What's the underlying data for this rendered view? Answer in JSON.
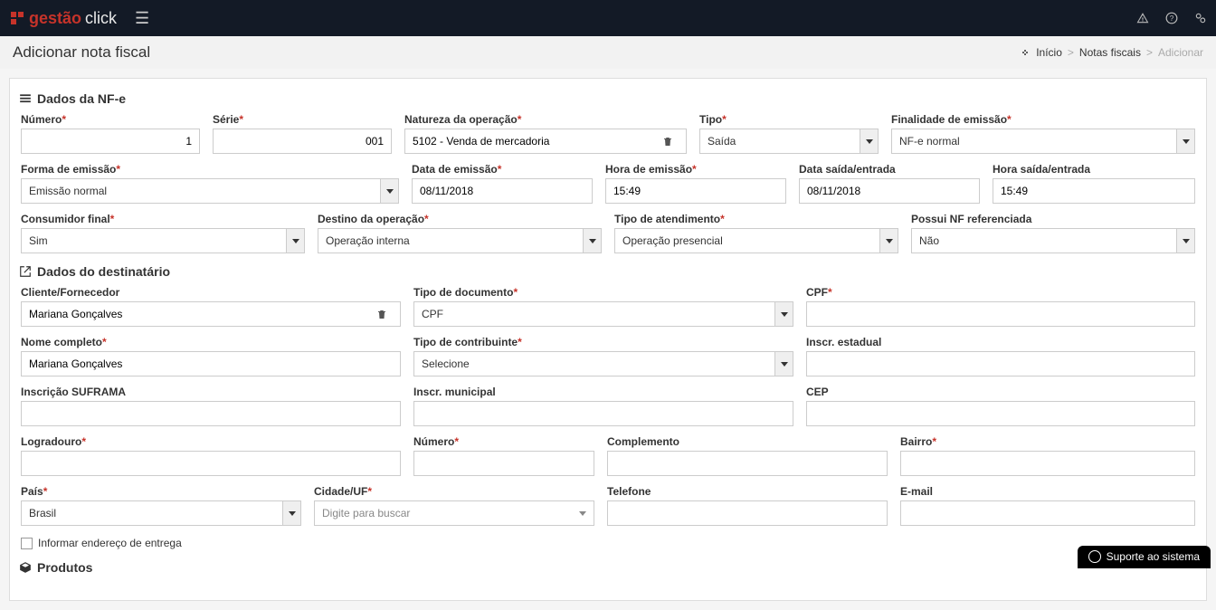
{
  "brand": {
    "part1": "gestão",
    "part2": "click"
  },
  "page": {
    "title": "Adicionar nota fiscal"
  },
  "breadcrumb": {
    "home": "Início",
    "parent": "Notas fiscais",
    "current": "Adicionar"
  },
  "sections": {
    "nfe": "Dados da NF-e",
    "dest": "Dados do destinatário",
    "products": "Produtos"
  },
  "labels": {
    "numero": "Número",
    "serie": "Série",
    "natureza": "Natureza da operação",
    "tipo": "Tipo",
    "finalidade": "Finalidade de emissão",
    "forma_emissao": "Forma de emissão",
    "data_emissao": "Data de emissão",
    "hora_emissao": "Hora de emissão",
    "data_saida": "Data saída/entrada",
    "hora_saida": "Hora saída/entrada",
    "consumidor_final": "Consumidor final",
    "destino_operacao": "Destino da operação",
    "tipo_atendimento": "Tipo de atendimento",
    "nf_ref": "Possui NF referenciada",
    "cliente": "Cliente/Fornecedor",
    "tipo_documento": "Tipo de documento",
    "cpf": "CPF",
    "nome_completo": "Nome completo",
    "tipo_contribuinte": "Tipo de contribuinte",
    "inscr_estadual": "Inscr. estadual",
    "inscr_suframa": "Inscrição SUFRAMA",
    "inscr_municipal": "Inscr. municipal",
    "cep": "CEP",
    "logradouro": "Logradouro",
    "numero_end": "Número",
    "complemento": "Complemento",
    "bairro": "Bairro",
    "pais": "País",
    "cidade_uf": "Cidade/UF",
    "telefone": "Telefone",
    "email": "E-mail",
    "informar_entrega": "Informar endereço de entrega"
  },
  "values": {
    "numero": "1",
    "serie": "001",
    "natureza": "5102 - Venda de mercadoria",
    "tipo": "Saída",
    "finalidade": "NF-e normal",
    "forma_emissao": "Emissão normal",
    "data_emissao": "08/11/2018",
    "hora_emissao": "15:49",
    "data_saida": "08/11/2018",
    "hora_saida": "15:49",
    "consumidor_final": "Sim",
    "destino_operacao": "Operação interna",
    "tipo_atendimento": "Operação presencial",
    "nf_ref": "Não",
    "cliente": "Mariana Gonçalves",
    "tipo_documento": "CPF",
    "nome_completo": "Mariana Gonçalves",
    "tipo_contribuinte": "Selecione",
    "pais": "Brasil",
    "cidade_placeholder": "Digite para buscar"
  },
  "support": "Suporte ao sistema"
}
